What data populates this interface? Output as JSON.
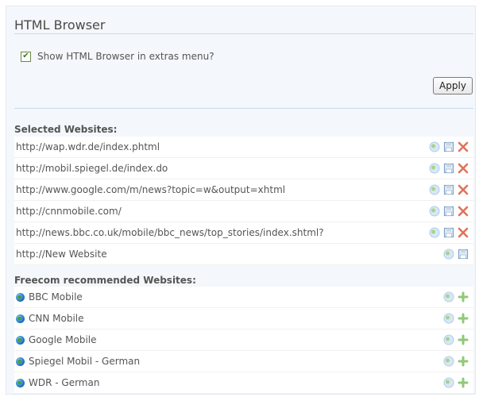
{
  "title": "HTML Browser",
  "option": {
    "label": "Show HTML Browser in extras menu?",
    "checked": true
  },
  "apply_label": "Apply",
  "selected": {
    "heading": "Selected Websites:",
    "items": [
      {
        "url": "http://wap.wdr.de/index.phtml",
        "icons": [
          "globe-icon",
          "save-icon",
          "delete-icon"
        ]
      },
      {
        "url": "http://mobil.spiegel.de/index.do",
        "icons": [
          "globe-icon",
          "save-icon",
          "delete-icon"
        ]
      },
      {
        "url": "http://www.google.com/m/news?topic=w&output=xhtml",
        "icons": [
          "globe-icon",
          "save-icon",
          "delete-icon"
        ]
      },
      {
        "url": "http://cnnmobile.com/",
        "icons": [
          "globe-icon",
          "save-icon",
          "delete-icon"
        ]
      },
      {
        "url": "http://news.bbc.co.uk/mobile/bbc_news/top_stories/index.shtml?",
        "icons": [
          "globe-icon",
          "save-icon",
          "delete-icon"
        ]
      },
      {
        "url": "http://New Website",
        "icons": [
          "globe-icon",
          "save-icon"
        ]
      }
    ]
  },
  "recommended": {
    "heading": "Freecom recommended Websites:",
    "items": [
      {
        "name": "BBC Mobile"
      },
      {
        "name": "CNN Mobile"
      },
      {
        "name": "Google Mobile"
      },
      {
        "name": "Spiegel Mobil - German"
      },
      {
        "name": "WDR - German"
      }
    ]
  },
  "colors": {
    "delete": "#e0735a",
    "save": "#7fa3c7",
    "add": "#8fc97a",
    "globe": "#bfd9ef"
  }
}
